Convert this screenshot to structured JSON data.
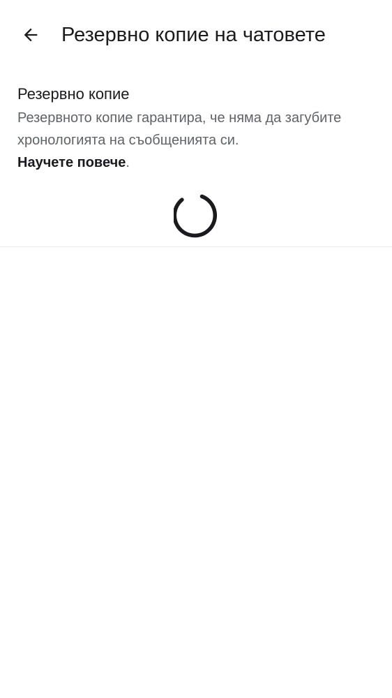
{
  "header": {
    "title": "Резервно копие на чатовете",
    "back_icon": "arrow-back-icon"
  },
  "backup_section": {
    "title": "Резервно копие",
    "description": "Резервното копие гарантира, че няма да загубите хронологията на съобщенията си.",
    "learn_more_label": "Научете повече",
    "trailing_period": "."
  },
  "loading": {
    "icon": "loading-spinner-icon"
  },
  "colors": {
    "text_primary": "#1b1b1f",
    "text_secondary": "#5f6368",
    "divider": "#e8e8ea",
    "background": "#ffffff"
  }
}
